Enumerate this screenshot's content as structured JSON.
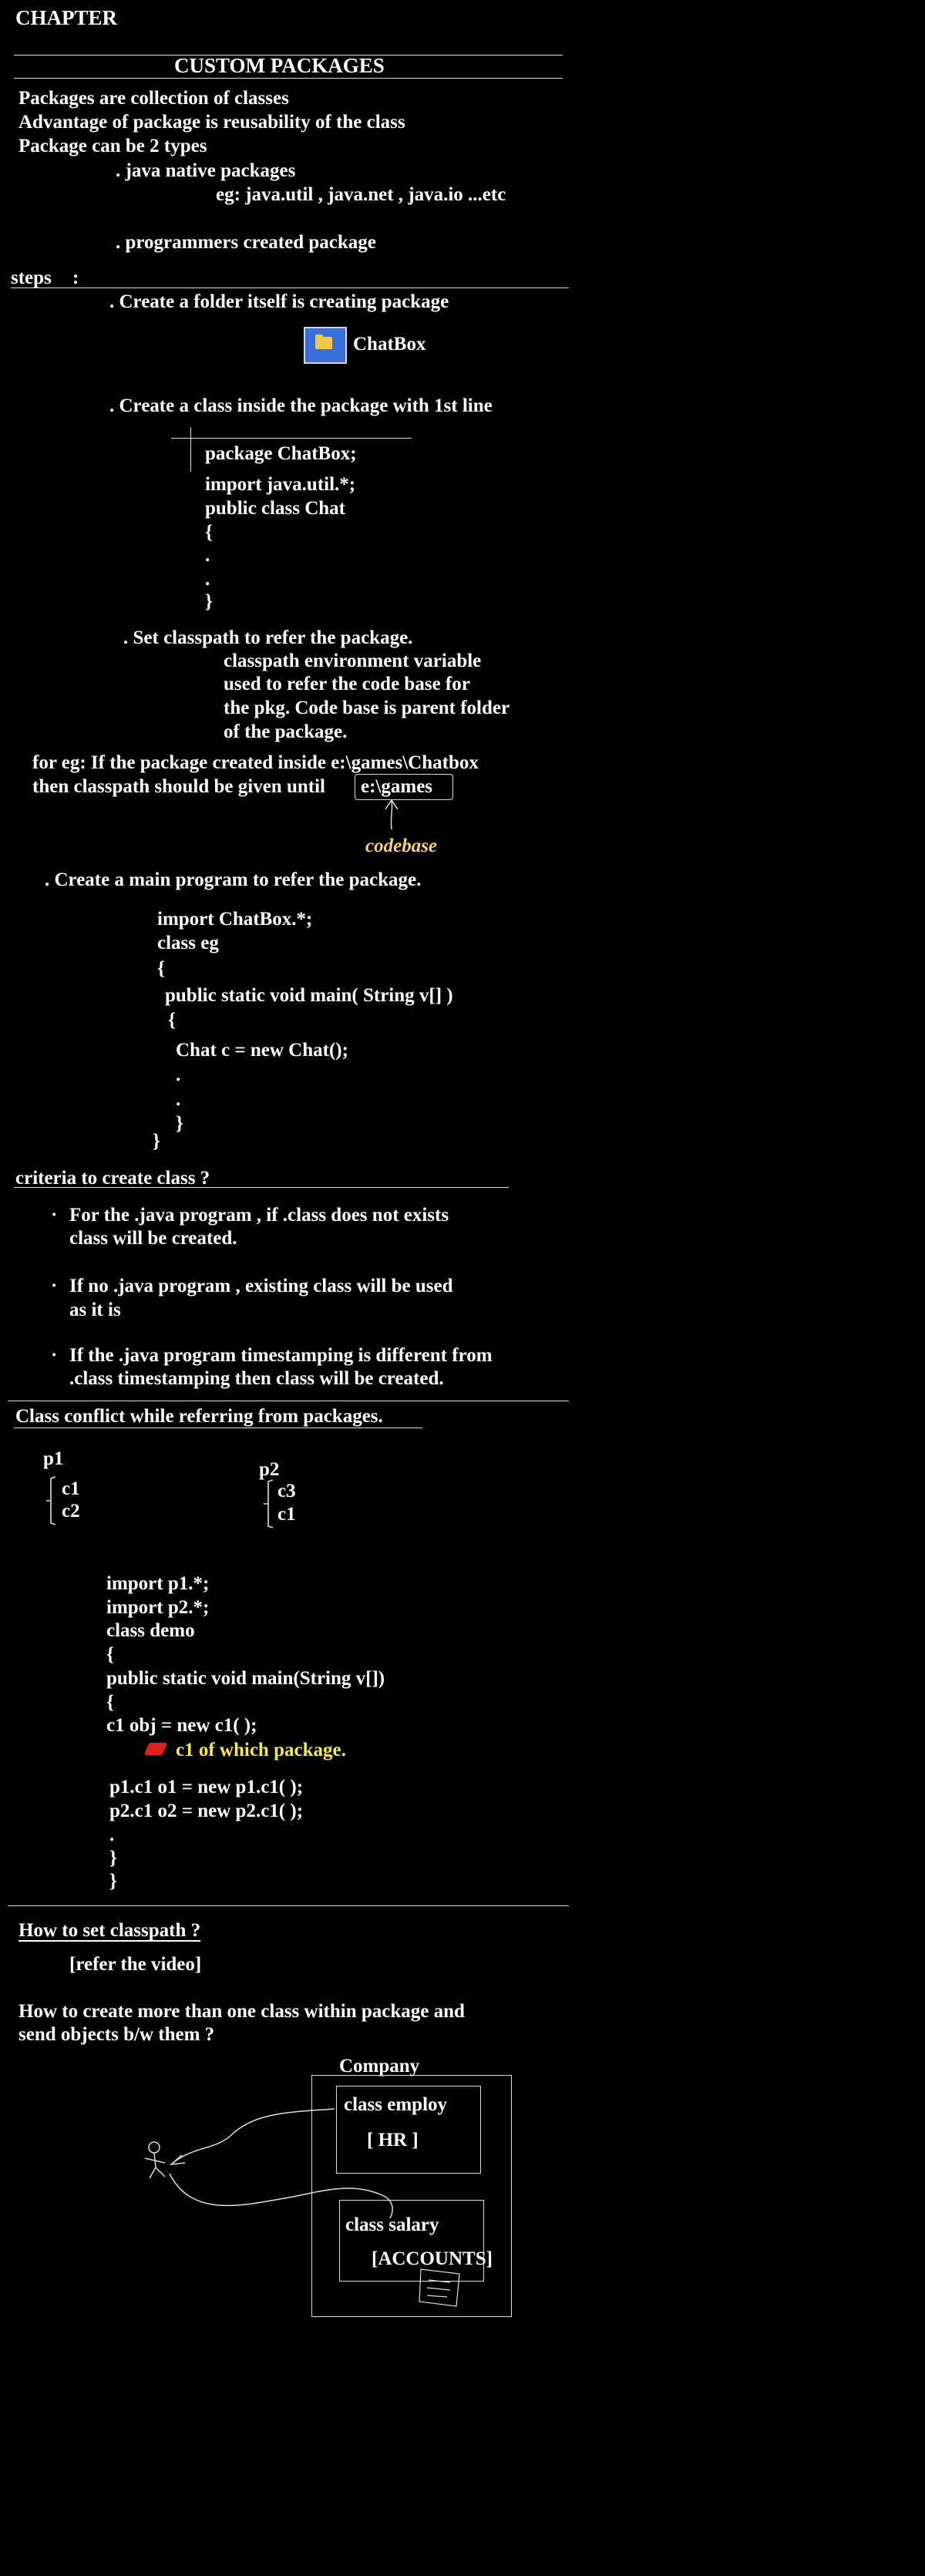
{
  "chapter_label": "CHAPTER",
  "title": "CUSTOM PACKAGES",
  "intro": [
    "Packages are collection of classes",
    "Advantage of package is reusability of the class",
    "Package can be 2 types"
  ],
  "types": {
    "native": ". java native packages",
    "native_eg": "eg: java.util , java.net , java.io ...etc",
    "programmer": ". programmers created package"
  },
  "steps": {
    "label": "steps",
    "colon": ":",
    "step1": ". Create a folder itself is creating package",
    "folder_name": "ChatBox",
    "step2": ". Create a class inside the package with 1st line",
    "code1": [
      "package  ChatBox;",
      "import java.util.*;",
      "public class Chat",
      "{",
      ".",
      ".",
      "}"
    ],
    "step3": ".  Set classpath to refer the package.",
    "step3_desc": [
      "classpath environment variable",
      "used to refer the code base for",
      "the pkg. Code base is parent folder",
      "of the package."
    ],
    "eg_line1": "for eg: If the package created inside e:\\games\\Chatbox",
    "eg_line2": "then classpath should be given until",
    "eg_path": "e:\\games",
    "codebase": "codebase",
    "step4": ". Create a main program to refer the package.",
    "code2": [
      "import ChatBox.*;",
      "class eg",
      "{",
      "public static void main( String v[] )",
      "{",
      "Chat c = new Chat();",
      ".",
      ".",
      "}",
      "}"
    ]
  },
  "criteria": {
    "heading": "criteria to create class ?",
    "bullets": [
      [
        "For the .java program , if .class does not exists",
        "class will be created."
      ],
      [
        "If no .java program , existing class will be used",
        "as it is"
      ],
      [
        "If the .java program timestamping is different from",
        ".class timestamping then class will be created."
      ]
    ],
    "bullet_char": "·"
  },
  "conflict": {
    "heading": "Class conflict while referring from packages.",
    "p1": {
      "name": "p1",
      "classes": [
        "c1",
        "c2"
      ]
    },
    "p2": {
      "name": "p2",
      "classes": [
        "c3",
        "c1"
      ]
    },
    "code": [
      "import p1.*;",
      "import p2.*;",
      "class demo",
      "public static void main(String v[])",
      "{",
      "c1  obj = new c1( );"
    ],
    "note": "c1 of which package.",
    "code_after": [
      "p1.c1  o1 = new p1.c1( );",
      "p2.c1  o2 = new p2.c1( );",
      ".",
      "}",
      "}"
    ]
  },
  "classpath": {
    "heading": "How to set classpath ?",
    "refer": "[refer the video]"
  },
  "question": [
    "How to create more than one class within package and",
    "send objects b/w them ?"
  ],
  "diagram": {
    "company": "Company",
    "employ": "class employ",
    "hr": "[ HR ]",
    "salary": "class salary",
    "accounts": "[ACCOUNTS]"
  },
  "colors": {
    "background": "#000000",
    "text": "#ffffff",
    "highlight": "#f6e84a",
    "codebase": "#f2d27a",
    "folder": "#3a6fd8"
  }
}
